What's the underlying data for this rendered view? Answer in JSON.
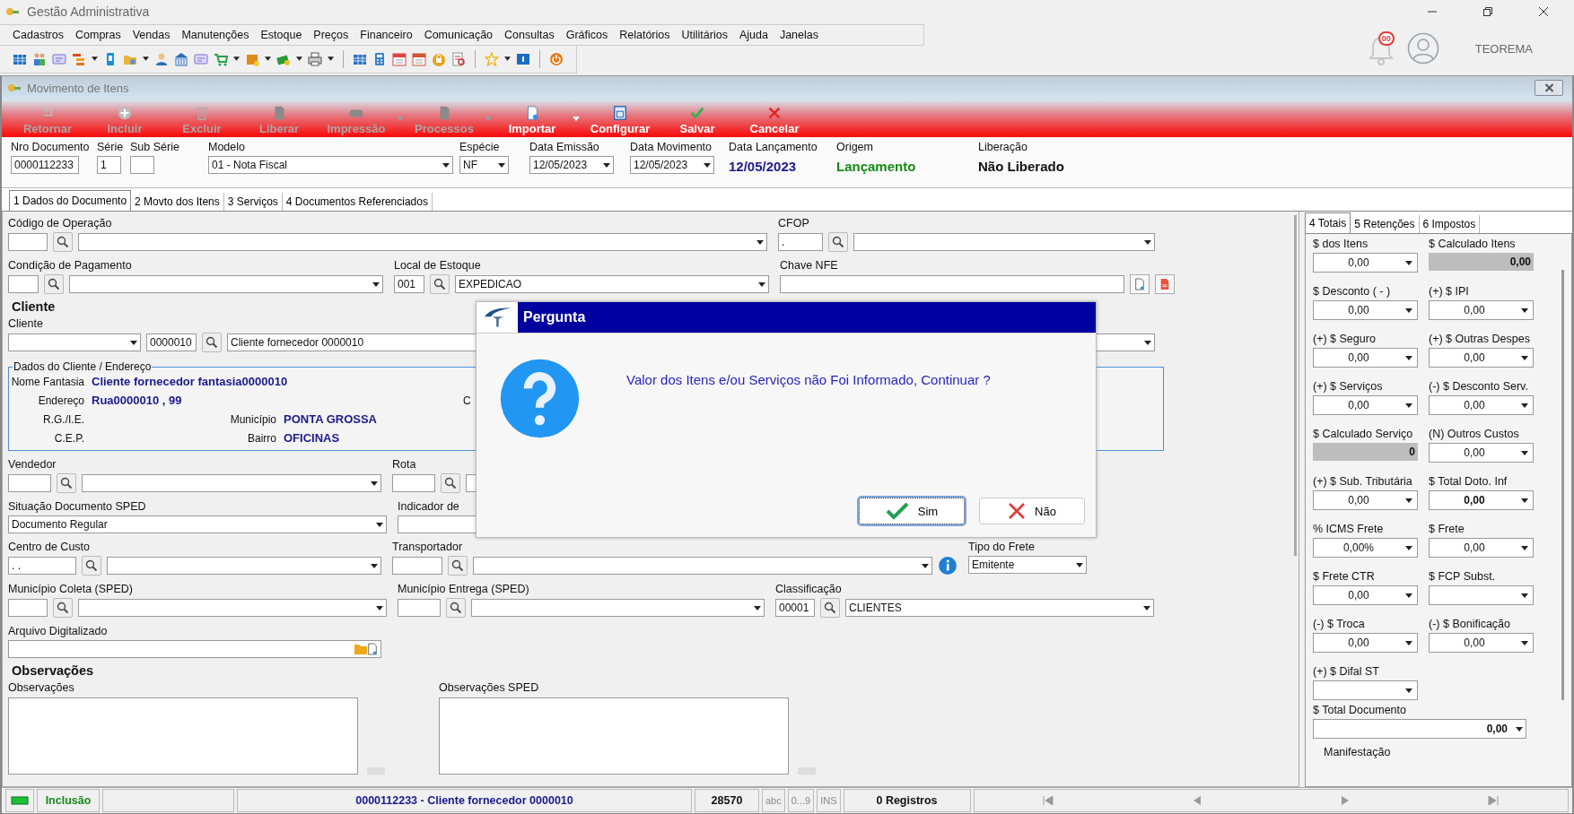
{
  "app": {
    "title": "Gestão Administrativa",
    "user": "TEOREMA",
    "notifications": "00"
  },
  "menu": [
    "Cadastros",
    "Compras",
    "Vendas",
    "Manutenções",
    "Estoque",
    "Preços",
    "Financeiro",
    "Comunicação",
    "Consultas",
    "Gráficos",
    "Relatórios",
    "Utilitários",
    "Ajuda",
    "Janelas"
  ],
  "window": {
    "title": "Movimento de Itens"
  },
  "toolbar": {
    "buttons": [
      {
        "label": "Retornar",
        "disabled": true,
        "dropdown": false
      },
      {
        "label": "Incluir",
        "disabled": true,
        "dropdown": false
      },
      {
        "label": "Excluir",
        "disabled": true,
        "dropdown": false
      },
      {
        "label": "Liberar",
        "disabled": true,
        "dropdown": false
      },
      {
        "label": "Impressão",
        "disabled": true,
        "dropdown": true
      },
      {
        "label": "Processos",
        "disabled": true,
        "dropdown": true
      },
      {
        "label": "Importar",
        "disabled": false,
        "dropdown": true
      },
      {
        "label": "Configurar",
        "disabled": false,
        "dropdown": false
      },
      {
        "label": "Salvar",
        "disabled": false,
        "dropdown": false
      },
      {
        "label": "Cancelar",
        "disabled": false,
        "dropdown": false
      }
    ]
  },
  "header": [
    {
      "label": "Nro Documento",
      "kind": "input",
      "value": "0000112233"
    },
    {
      "label": "Série",
      "kind": "input",
      "value": "1"
    },
    {
      "label": "Sub Série",
      "kind": "input"
    },
    {
      "label": "Modelo",
      "kind": "combo",
      "value": "01 - Nota Fiscal"
    },
    {
      "label": "Espécie",
      "kind": "combo",
      "value": "NF"
    },
    {
      "label": "Data Emissão",
      "kind": "combo",
      "value": "12/05/2023"
    },
    {
      "label": "Data Movimento",
      "kind": "combo",
      "value": "12/05/2023"
    },
    {
      "label": "Data Lançamento",
      "kind": "display",
      "value": "12/05/2023",
      "color": "#1a1a8c"
    },
    {
      "label": "Origem",
      "kind": "display",
      "value": "Lançamento",
      "color": "#168a16"
    },
    {
      "label": "Liberação",
      "kind": "display",
      "value": "Não Liberado",
      "color": "#111111"
    }
  ],
  "tabs": [
    {
      "label": "1 Dados do Documento",
      "selected": true
    },
    {
      "label": "2 Movto dos Itens",
      "selected": false
    },
    {
      "label": "3 Serviços",
      "selected": false
    },
    {
      "label": "4 Documentos Referenciados",
      "selected": false
    }
  ],
  "form": {
    "rows": [
      {
        "kind": "fields",
        "groups": [
          {
            "label": "Código de Operação",
            "controls": [
              {
                "kind": "input"
              },
              {
                "kind": "search"
              },
              {
                "kind": "combo"
              }
            ]
          },
          {
            "label": "CFOP",
            "controls": [
              {
                "kind": "input",
                "value": "."
              },
              {
                "kind": "search"
              },
              {
                "kind": "combo"
              }
            ]
          }
        ]
      },
      {
        "kind": "fields",
        "groups": [
          {
            "label": "Condição de Pagamento",
            "controls": [
              {
                "kind": "input"
              },
              {
                "kind": "search"
              },
              {
                "kind": "combo"
              }
            ]
          },
          {
            "label": "Local de Estoque",
            "controls": [
              {
                "kind": "input",
                "value": "001"
              },
              {
                "kind": "search"
              },
              {
                "kind": "combo",
                "value": "EXPEDICAO"
              }
            ]
          },
          {
            "label": "Chave NFE",
            "controls": [
              {
                "kind": "text"
              },
              {
                "kind": "doc"
              },
              {
                "kind": "pdf"
              }
            ]
          }
        ]
      },
      {
        "kind": "heading",
        "label": "Cliente"
      },
      {
        "kind": "fields",
        "groups": [
          {
            "label": "Cliente",
            "controls": [
              {
                "kind": "combo"
              },
              {
                "kind": "input",
                "value": "0000010"
              },
              {
                "kind": "search"
              },
              {
                "kind": "combo",
                "value": "Cliente fornecedor 0000010"
              }
            ]
          }
        ]
      },
      {
        "kind": "client_box"
      },
      {
        "kind": "fields",
        "groups": [
          {
            "label": "Vendedor",
            "controls": [
              {
                "kind": "input"
              },
              {
                "kind": "search"
              },
              {
                "kind": "combo"
              }
            ]
          },
          {
            "label": "Rota",
            "controls": [
              {
                "kind": "input"
              },
              {
                "kind": "search"
              },
              {
                "kind": "text"
              }
            ]
          }
        ]
      },
      {
        "kind": "fields",
        "groups": [
          {
            "label": "Situação Documento SPED",
            "controls": [
              {
                "kind": "combo",
                "value": "Documento Regular"
              }
            ]
          },
          {
            "label": "Indicador de",
            "controls": [
              {
                "kind": "text"
              }
            ]
          }
        ]
      },
      {
        "kind": "fields",
        "groups": [
          {
            "label": "Centro de Custo",
            "controls": [
              {
                "kind": "input",
                "value": " .  ."
              },
              {
                "kind": "search"
              },
              {
                "kind": "combo"
              }
            ]
          },
          {
            "label": "Transportador",
            "controls": [
              {
                "kind": "input"
              },
              {
                "kind": "search"
              },
              {
                "kind": "combo"
              },
              {
                "kind": "info"
              }
            ]
          },
          {
            "label": "Tipo do Frete",
            "controls": [
              {
                "kind": "combo",
                "value": "Emitente"
              }
            ]
          }
        ]
      },
      {
        "kind": "fields",
        "groups": [
          {
            "label": "Município Coleta (SPED)",
            "controls": [
              {
                "kind": "input"
              },
              {
                "kind": "search"
              },
              {
                "kind": "combo"
              }
            ]
          },
          {
            "label": "Município Entrega (SPED)",
            "controls": [
              {
                "kind": "input"
              },
              {
                "kind": "search"
              },
              {
                "kind": "combo"
              }
            ]
          },
          {
            "label": "Classificação",
            "controls": [
              {
                "kind": "input",
                "value": "00001"
              },
              {
                "kind": "search"
              },
              {
                "kind": "combo",
                "value": "CLIENTES"
              }
            ]
          }
        ]
      },
      {
        "kind": "fields",
        "groups": [
          {
            "label": "Arquivo Digitalizado",
            "controls": [
              {
                "kind": "file"
              }
            ]
          }
        ]
      },
      {
        "kind": "heading",
        "label": "Observações"
      },
      {
        "kind": "notes",
        "labels": [
          "Observações",
          "Observações SPED"
        ]
      }
    ]
  },
  "client_box": {
    "title": "Dados do Cliente / Endereço",
    "lines": [
      [
        {
          "label": "Nome Fantasia",
          "value": "Cliente fornecedor fantasia0000010"
        }
      ],
      [
        {
          "label": "Endereço",
          "value": "Rua0000010 , 99"
        }
      ],
      [
        {
          "label": "R.G./I.E."
        },
        {
          "label": "Município",
          "value": "PONTA GROSSA"
        }
      ],
      [
        {
          "label": "C.E.P."
        },
        {
          "label": "Bairro",
          "value": "OFICINAS"
        }
      ]
    ],
    "side_label": "C"
  },
  "totals": {
    "tabs": [
      {
        "label": "4 Totais",
        "selected": true
      },
      {
        "label": "5 Retenções",
        "selected": false
      },
      {
        "label": "6 Impostos",
        "selected": false
      }
    ],
    "fields": [
      {
        "label": "$ dos Itens",
        "value": "0,00",
        "kind": "combo",
        "bold": false
      },
      {
        "label": "$ Calculado Itens",
        "value": "0,00",
        "kind": "readonly",
        "bold": true
      },
      {
        "label": "$ Desconto ( - )",
        "value": "0,00",
        "kind": "combo",
        "bold": false
      },
      {
        "label": "(+) $ IPI",
        "value": "0,00",
        "kind": "combo",
        "bold": false
      },
      {
        "label": "(+) $ Seguro",
        "value": "0,00",
        "kind": "combo",
        "bold": false
      },
      {
        "label": "(+) $ Outras Despes",
        "value": "0,00",
        "kind": "combo",
        "bold": false
      },
      {
        "label": "(+) $ Serviços",
        "value": "0,00",
        "kind": "combo",
        "bold": false
      },
      {
        "label": "(-) $ Desconto Serv.",
        "value": "0,00",
        "kind": "combo",
        "bold": false
      },
      {
        "label": "$ Calculado Serviço",
        "value": "0",
        "kind": "readonly",
        "bold": true
      },
      {
        "label": "(N) Outros Custos",
        "value": "0,00",
        "kind": "combo",
        "bold": false
      },
      {
        "label": "(+) $ Sub. Tributária",
        "value": "0,00",
        "kind": "combo",
        "bold": false
      },
      {
        "label": "$ Total Doto. Inf",
        "value": "0,00",
        "kind": "combo",
        "bold": true
      },
      {
        "label": "% ICMS Frete",
        "value": "0,00%",
        "kind": "combo",
        "bold": false
      },
      {
        "label": "$ Frete",
        "value": "0,00",
        "kind": "combo",
        "bold": false
      },
      {
        "label": "$ Frete CTR",
        "value": "0,00",
        "kind": "combo",
        "bold": false
      },
      {
        "label": "$ FCP Subst.",
        "kind": "combo"
      },
      {
        "label": "(-) $ Troca",
        "value": "0,00",
        "kind": "combo",
        "bold": false
      },
      {
        "label": "(-) $ Bonificação",
        "value": "0,00",
        "kind": "combo",
        "bold": false
      },
      {
        "label": "(+) $ Difal ST",
        "kind": "combo"
      }
    ],
    "total": {
      "label": "$ Total Documento",
      "value": "0,00"
    },
    "footer_label": "Manifestação"
  },
  "status_bar": {
    "mode": "Inclusão",
    "document": "0000112233 - Cliente fornecedor 0000010",
    "code": "28570",
    "indicators": [
      "abc",
      "0...9",
      "INS"
    ],
    "records": "0 Registros"
  },
  "dialog": {
    "title": "Pergunta",
    "message": "Valor dos Itens e/ou Serviços não Foi Informado, Continuar ?",
    "buttons": [
      {
        "label": "Sim",
        "focused": true
      },
      {
        "label": "Não",
        "focused": false
      }
    ]
  }
}
